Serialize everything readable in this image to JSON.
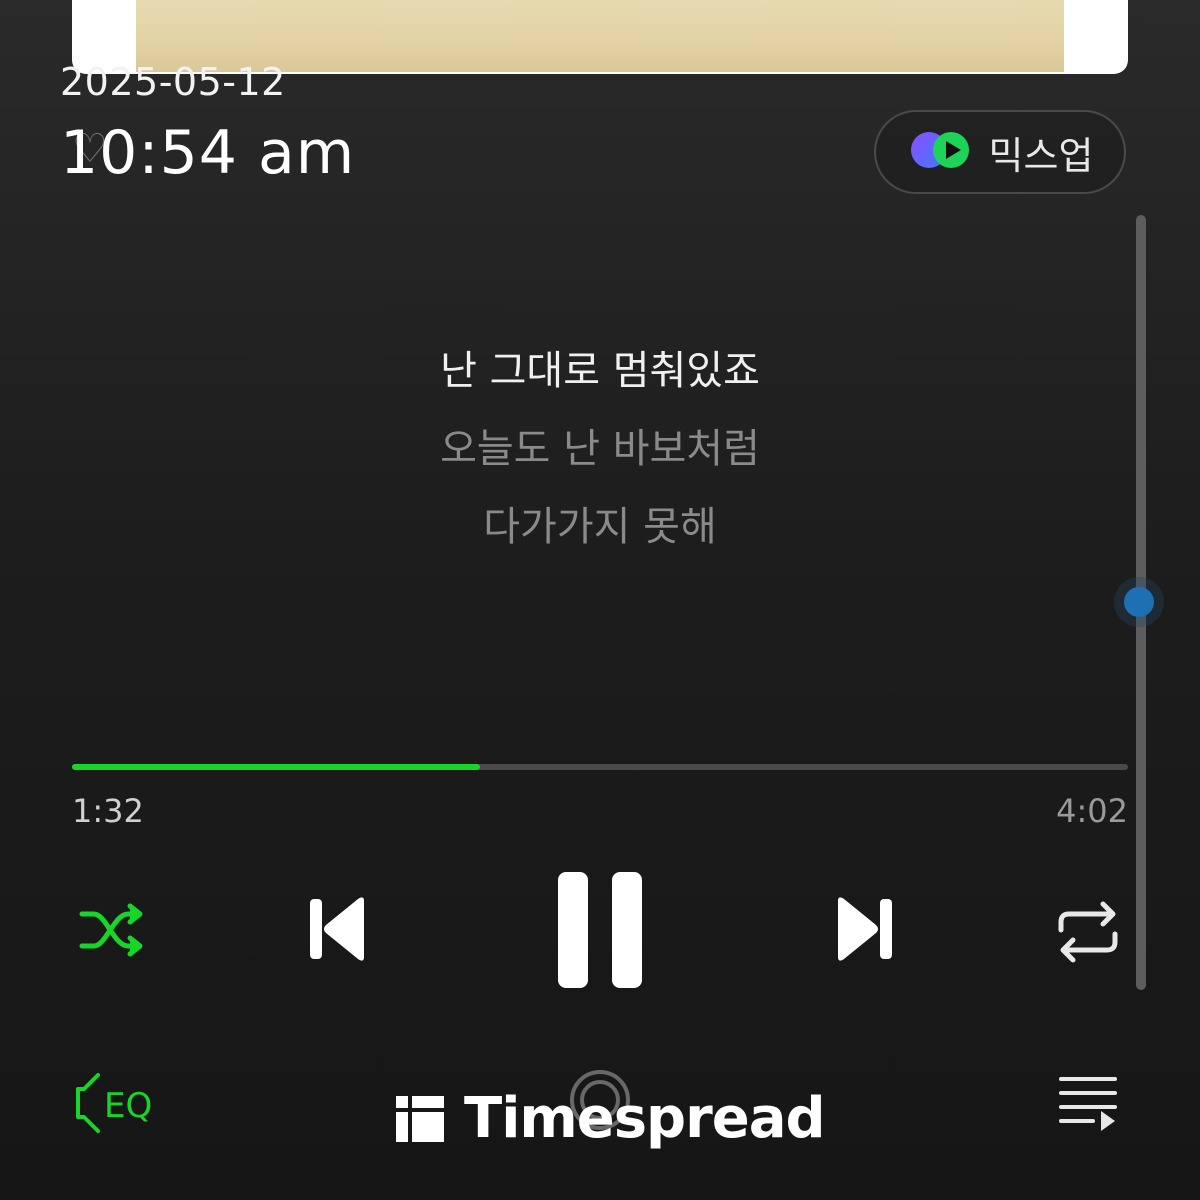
{
  "player": {
    "mixup_label": "믹스업",
    "lyrics": {
      "current": "난 그대로 멈춰있죠",
      "next_1": "오늘도 난 바보처럼",
      "next_2": "다가가지 못해"
    },
    "progress": {
      "elapsed": "1:32",
      "total": "4:02",
      "fraction": 0.386
    },
    "controls": {
      "shuffle_icon": "shuffle-icon",
      "previous_icon": "skip-previous-icon",
      "play_state_icon": "pause-icon",
      "next_icon": "skip-next-icon",
      "repeat_icon": "repeat-icon",
      "eq_icon": "eq-speaker-icon",
      "queue_icon": "playlist-icon"
    },
    "colors": {
      "accent_green": "#17d627",
      "scroll_thumb": "#1f6fb5"
    }
  },
  "overlay": {
    "date": "2025-05-12",
    "time": "10:54 am",
    "watermark": "Timespread"
  }
}
